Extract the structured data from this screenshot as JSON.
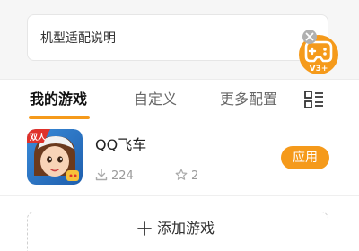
{
  "info_card": {
    "label": "机型适配说明"
  },
  "badge": {
    "text": "V3+",
    "icon": "gamepad-icon",
    "color": "#f59a1b"
  },
  "tabs": [
    {
      "label": "我的游戏",
      "active": true
    },
    {
      "label": "自定义",
      "active": false
    },
    {
      "label": "更多配置",
      "active": false
    }
  ],
  "accent_color": "#f59a1b",
  "game": {
    "name": "QQ飞车",
    "downloads": "224",
    "stars": "2",
    "apply_label": "应用",
    "icon_badge_text": "双人"
  },
  "add_game": {
    "label": "添加游戏"
  }
}
